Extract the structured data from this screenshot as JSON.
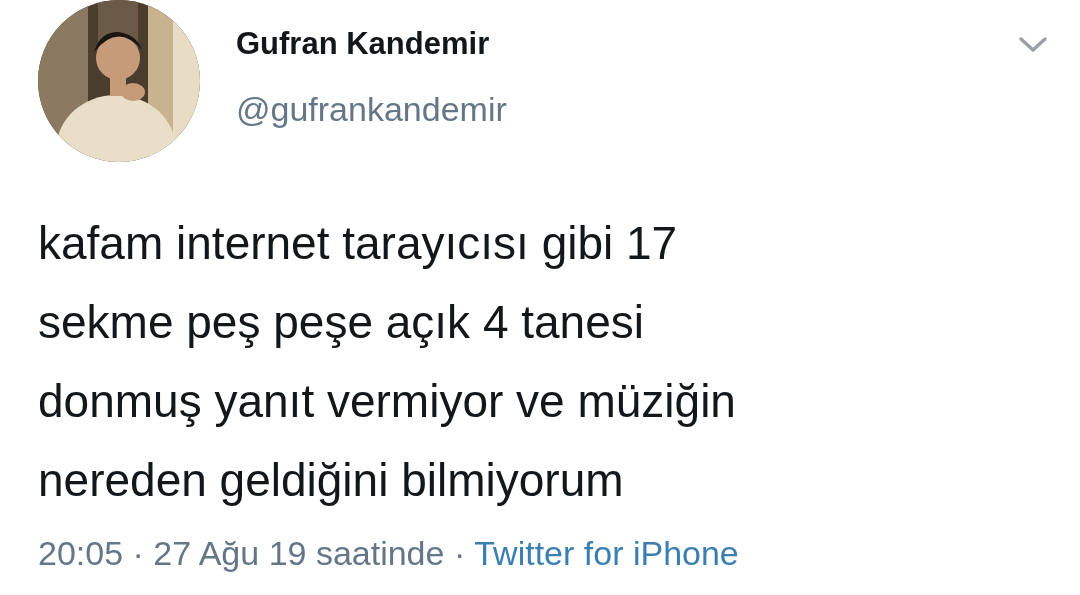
{
  "tweet": {
    "name": "Gufran Kandemir",
    "handle": "@gufrankandemir",
    "text": "kafam internet tarayıcısı gibi 17\nsekme peş peşe açık 4 tanesi\ndonmuş yanıt vermiyor ve müziğin\nnereden geldiğini bilmiyorum",
    "time": "20:05 · 27 Ağu 19 saatinde ·",
    "source": "Twitter for iPhone"
  }
}
